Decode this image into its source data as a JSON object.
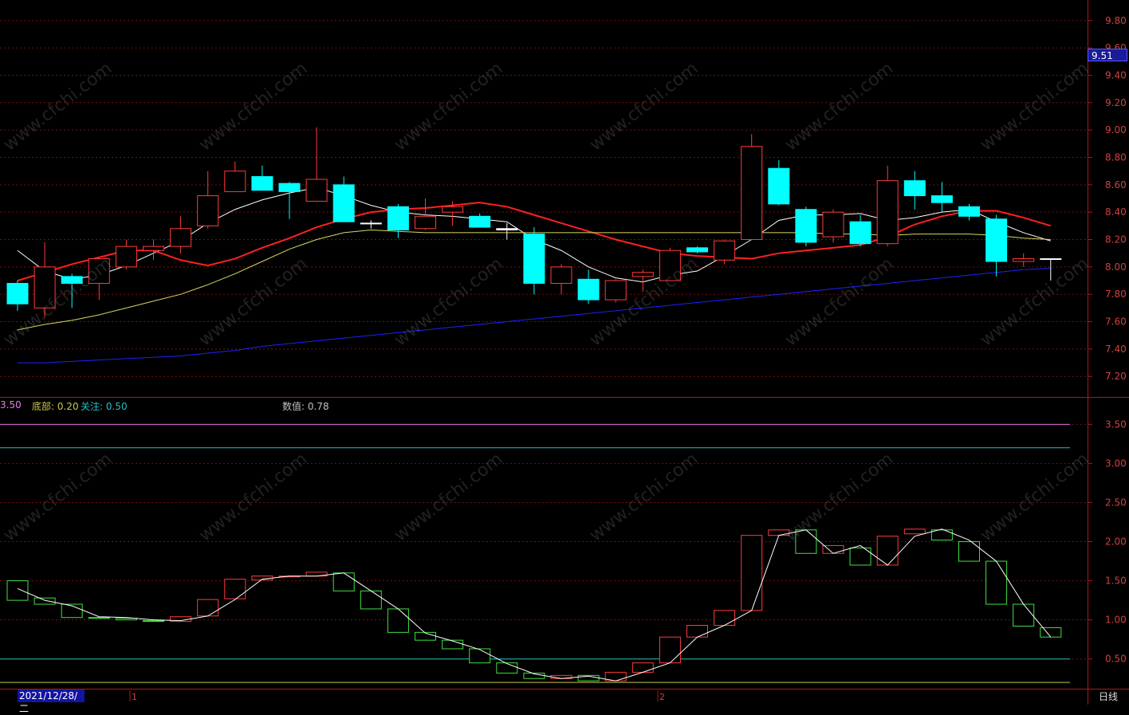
{
  "chart_data": [
    {
      "type": "candlestick",
      "panel": "main",
      "ylim": [
        7.05,
        9.95
      ],
      "yticks": [
        "9.80",
        "9.60",
        "9.40",
        "9.20",
        "9.00",
        "8.80",
        "8.60",
        "8.40",
        "8.20",
        "8.00",
        "7.80",
        "7.60",
        "7.40",
        "7.20"
      ],
      "last_price_label": "9.51",
      "up_color": "#ff3b3b",
      "down_color": "#00ffff",
      "candles": [
        {
          "o": 7.88,
          "h": 7.9,
          "l": 7.68,
          "c": 7.73
        },
        {
          "o": 7.7,
          "h": 8.18,
          "l": 7.63,
          "c": 8.0
        },
        {
          "o": 7.93,
          "h": 7.95,
          "l": 7.7,
          "c": 7.88
        },
        {
          "o": 7.88,
          "h": 8.06,
          "l": 7.76,
          "c": 8.06
        },
        {
          "o": 8.0,
          "h": 8.2,
          "l": 7.98,
          "c": 8.15
        },
        {
          "o": 8.12,
          "h": 8.2,
          "l": 8.05,
          "c": 8.15
        },
        {
          "o": 8.15,
          "h": 8.37,
          "l": 8.1,
          "c": 8.28
        },
        {
          "o": 8.3,
          "h": 8.7,
          "l": 8.28,
          "c": 8.52
        },
        {
          "o": 8.55,
          "h": 8.77,
          "l": 8.55,
          "c": 8.7
        },
        {
          "o": 8.66,
          "h": 8.74,
          "l": 8.56,
          "c": 8.56
        },
        {
          "o": 8.61,
          "h": 8.62,
          "l": 8.35,
          "c": 8.55
        },
        {
          "o": 8.48,
          "h": 9.02,
          "l": 8.48,
          "c": 8.64
        },
        {
          "o": 8.6,
          "h": 8.66,
          "l": 8.33,
          "c": 8.33
        },
        {
          "o": 8.32,
          "h": 8.34,
          "l": 8.28,
          "c": 8.32
        },
        {
          "o": 8.44,
          "h": 8.46,
          "l": 8.21,
          "c": 8.27
        },
        {
          "o": 8.28,
          "h": 8.5,
          "l": 8.27,
          "c": 8.37
        },
        {
          "o": 8.4,
          "h": 8.48,
          "l": 8.3,
          "c": 8.44
        },
        {
          "o": 8.37,
          "h": 8.39,
          "l": 8.3,
          "c": 8.29
        },
        {
          "o": 8.28,
          "h": 8.32,
          "l": 8.2,
          "c": 8.27
        },
        {
          "o": 8.24,
          "h": 8.29,
          "l": 7.8,
          "c": 7.88
        },
        {
          "o": 7.88,
          "h": 8.02,
          "l": 7.8,
          "c": 8.0
        },
        {
          "o": 7.91,
          "h": 7.98,
          "l": 7.73,
          "c": 7.76
        },
        {
          "o": 7.76,
          "h": 7.91,
          "l": 7.74,
          "c": 7.9
        },
        {
          "o": 7.93,
          "h": 7.98,
          "l": 7.82,
          "c": 7.96
        },
        {
          "o": 7.9,
          "h": 8.14,
          "l": 7.9,
          "c": 8.12
        },
        {
          "o": 8.14,
          "h": 8.15,
          "l": 8.1,
          "c": 8.11
        },
        {
          "o": 8.05,
          "h": 8.2,
          "l": 8.02,
          "c": 8.19
        },
        {
          "o": 8.2,
          "h": 8.97,
          "l": 8.2,
          "c": 8.88
        },
        {
          "o": 8.72,
          "h": 8.78,
          "l": 8.45,
          "c": 8.46
        },
        {
          "o": 8.42,
          "h": 8.44,
          "l": 8.15,
          "c": 8.18
        },
        {
          "o": 8.22,
          "h": 8.42,
          "l": 8.18,
          "c": 8.4
        },
        {
          "o": 8.33,
          "h": 8.38,
          "l": 8.15,
          "c": 8.17
        },
        {
          "o": 8.17,
          "h": 8.74,
          "l": 8.15,
          "c": 8.63
        },
        {
          "o": 8.63,
          "h": 8.7,
          "l": 8.42,
          "c": 8.52
        },
        {
          "o": 8.52,
          "h": 8.62,
          "l": 8.4,
          "c": 8.47
        },
        {
          "o": 8.44,
          "h": 8.46,
          "l": 8.34,
          "c": 8.37
        },
        {
          "o": 8.35,
          "h": 8.38,
          "l": 7.93,
          "c": 8.04
        },
        {
          "o": 8.04,
          "h": 8.1,
          "l": 8.0,
          "c": 8.06
        },
        {
          "o": 8.06,
          "h": 8.06,
          "l": 7.9,
          "c": 8.06
        }
      ],
      "series": [
        {
          "color": "#ffffff",
          "width": 1,
          "values": [
            8.12,
            7.97,
            7.91,
            7.94,
            8.01,
            8.1,
            8.19,
            8.32,
            8.42,
            8.49,
            8.54,
            8.58,
            8.52,
            8.45,
            8.4,
            8.38,
            8.37,
            8.35,
            8.33,
            8.2,
            8.12,
            8.0,
            7.92,
            7.89,
            7.94,
            7.97,
            8.08,
            8.2,
            8.34,
            8.38,
            8.38,
            8.39,
            8.34,
            8.36,
            8.4,
            8.42,
            8.33,
            8.25,
            8.19
          ]
        },
        {
          "color": "#ff2020",
          "width": 2,
          "values": [
            7.9,
            7.96,
            8.02,
            8.07,
            8.12,
            8.12,
            8.05,
            8.01,
            8.06,
            8.14,
            8.21,
            8.29,
            8.35,
            8.4,
            8.42,
            8.43,
            8.45,
            8.47,
            8.44,
            8.38,
            8.32,
            8.26,
            8.2,
            8.15,
            8.1,
            8.08,
            8.07,
            8.06,
            8.1,
            8.12,
            8.14,
            8.16,
            8.22,
            8.31,
            8.37,
            8.41,
            8.41,
            8.36,
            8.3
          ]
        },
        {
          "color": "#d8d860",
          "width": 1,
          "values": [
            7.54,
            7.58,
            7.61,
            7.65,
            7.7,
            7.75,
            7.8,
            7.87,
            7.95,
            8.04,
            8.13,
            8.2,
            8.25,
            8.27,
            8.26,
            8.25,
            8.25,
            8.25,
            8.25,
            8.25,
            8.25,
            8.25,
            8.25,
            8.25,
            8.25,
            8.25,
            8.25,
            8.25,
            8.25,
            8.25,
            8.24,
            8.24,
            8.23,
            8.24,
            8.24,
            8.24,
            8.23,
            8.21,
            8.2
          ]
        },
        {
          "color": "#2020ff",
          "width": 1,
          "values": [
            7.3,
            7.3,
            7.31,
            7.32,
            7.33,
            7.34,
            7.35,
            7.37,
            7.39,
            7.42,
            7.44,
            7.46,
            7.48,
            7.5,
            7.52,
            7.54,
            7.56,
            7.58,
            7.6,
            7.62,
            7.64,
            7.66,
            7.68,
            7.7,
            7.72,
            7.74,
            7.76,
            7.78,
            7.8,
            7.82,
            7.84,
            7.86,
            7.88,
            7.9,
            7.92,
            7.94,
            7.96,
            7.98,
            7.99
          ]
        }
      ]
    },
    {
      "type": "candlestick",
      "panel": "indicator",
      "ylim": [
        0.12,
        3.85
      ],
      "yticks": [
        "3.50",
        "3.00",
        "2.50",
        "2.00",
        "1.50",
        "1.00",
        "0.50"
      ],
      "legend": [
        {
          "text": "3.50",
          "color": "#e080e0"
        },
        {
          "text": "底部: 0.20",
          "color": "#c8c850"
        },
        {
          "text": "关注: 0.50",
          "color": "#20c0c0"
        },
        {
          "text": "数值: 0.78",
          "color": "#c0c0c0"
        }
      ],
      "hlines": [
        {
          "value": 3.5,
          "color": "#e070e0"
        },
        {
          "value": 3.2,
          "color": "#20c0c0"
        },
        {
          "value": 0.5,
          "color": "#20c0c0"
        },
        {
          "value": 0.2,
          "color": "#c8c850"
        }
      ],
      "up_color": "#ff3b3b",
      "down_color": "#40e040",
      "bars": [
        {
          "o": 1.5,
          "c": 1.25
        },
        {
          "o": 1.28,
          "c": 1.2
        },
        {
          "o": 1.2,
          "c": 1.03
        },
        {
          "o": 1.03,
          "c": 1.02
        },
        {
          "o": 1.02,
          "c": 1.0
        },
        {
          "o": 0.99,
          "c": 0.98
        },
        {
          "o": 0.98,
          "c": 1.04
        },
        {
          "o": 1.05,
          "c": 1.26
        },
        {
          "o": 1.27,
          "c": 1.52
        },
        {
          "o": 1.51,
          "c": 1.56
        },
        {
          "o": 1.56,
          "c": 1.56
        },
        {
          "o": 1.56,
          "c": 1.61
        },
        {
          "o": 1.6,
          "c": 1.37
        },
        {
          "o": 1.37,
          "c": 1.14
        },
        {
          "o": 1.14,
          "c": 0.84
        },
        {
          "o": 0.84,
          "c": 0.74
        },
        {
          "o": 0.74,
          "c": 0.63
        },
        {
          "o": 0.63,
          "c": 0.45
        },
        {
          "o": 0.45,
          "c": 0.32
        },
        {
          "o": 0.32,
          "c": 0.25
        },
        {
          "o": 0.25,
          "c": 0.29
        },
        {
          "o": 0.29,
          "c": 0.22
        },
        {
          "o": 0.22,
          "c": 0.33
        },
        {
          "o": 0.33,
          "c": 0.45
        },
        {
          "o": 0.45,
          "c": 0.78
        },
        {
          "o": 0.78,
          "c": 0.93
        },
        {
          "o": 0.93,
          "c": 1.12
        },
        {
          "o": 1.12,
          "c": 2.08
        },
        {
          "o": 2.08,
          "c": 2.15
        },
        {
          "o": 2.15,
          "c": 1.85
        },
        {
          "o": 1.85,
          "c": 1.95
        },
        {
          "o": 1.92,
          "c": 1.7
        },
        {
          "o": 1.7,
          "c": 2.07
        },
        {
          "o": 2.1,
          "c": 2.16
        },
        {
          "o": 2.15,
          "c": 2.02
        },
        {
          "o": 2.0,
          "c": 1.75
        },
        {
          "o": 1.75,
          "c": 1.2
        },
        {
          "o": 1.2,
          "c": 0.92
        },
        {
          "o": 0.9,
          "c": 0.78
        }
      ],
      "line": {
        "color": "#ffffff",
        "values": [
          1.4,
          1.25,
          1.18,
          1.04,
          1.03,
          1.0,
          0.99,
          1.05,
          1.26,
          1.52,
          1.56,
          1.56,
          1.6,
          1.37,
          1.14,
          0.83,
          0.73,
          0.62,
          0.44,
          0.31,
          0.25,
          0.28,
          0.22,
          0.33,
          0.45,
          0.78,
          0.93,
          1.12,
          2.08,
          2.15,
          1.85,
          1.95,
          1.7,
          2.07,
          2.16,
          2.02,
          1.75,
          1.2,
          0.78
        ]
      }
    }
  ],
  "date_label": "2021/12/28/二",
  "period_label": "日线",
  "month_marks": [
    "1",
    "2"
  ],
  "watermark": "www.cfchi.com"
}
